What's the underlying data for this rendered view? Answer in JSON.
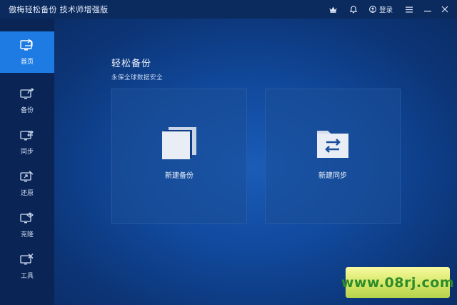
{
  "window": {
    "title": "傲梅轻松备份 技术师增强版"
  },
  "titlebar": {
    "crown_icon": "crown-icon",
    "bell_icon": "bell-icon",
    "login_label": "登录",
    "menu_icon": "menu-icon",
    "minimize_icon": "minimize-icon",
    "close_icon": "close-icon"
  },
  "sidebar": {
    "items": [
      {
        "label": "首页",
        "icon": "home-monitor-icon",
        "active": true
      },
      {
        "label": "备份",
        "icon": "backup-monitor-icon",
        "active": false
      },
      {
        "label": "同步",
        "icon": "sync-monitor-icon",
        "active": false
      },
      {
        "label": "还原",
        "icon": "restore-monitor-icon",
        "active": false
      },
      {
        "label": "克隆",
        "icon": "clone-monitor-icon",
        "active": false
      },
      {
        "label": "工具",
        "icon": "tools-monitor-icon",
        "active": false
      }
    ]
  },
  "main": {
    "title": "轻松备份",
    "subtitle": "永保全球数据安全",
    "cards": [
      {
        "label": "新建备份",
        "icon": "stacked-pages-icon"
      },
      {
        "label": "新建同步",
        "icon": "folder-sync-icon"
      }
    ]
  },
  "watermark": {
    "text": "www.08rj.com"
  },
  "colors": {
    "accent": "#1d7be3",
    "sidebar_bg": "#0a2555",
    "titlebar_bg": "#0b2a5e",
    "main_bg": "#114a9e"
  }
}
